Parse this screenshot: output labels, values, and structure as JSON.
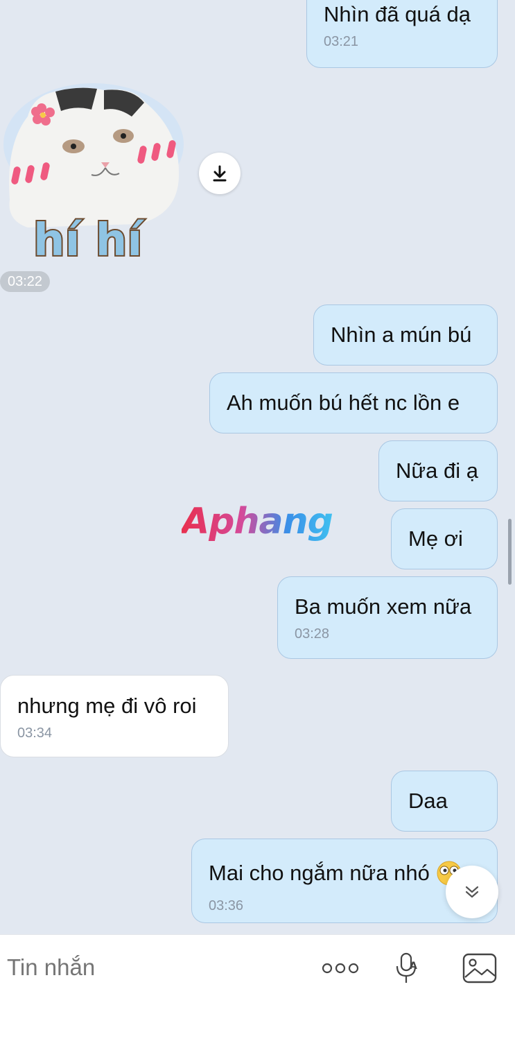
{
  "messages": [
    {
      "text": "Nhìn đã quá dạ",
      "time": "03:21"
    },
    {
      "sticker_text": "hí hí",
      "time": "03:22"
    },
    {
      "text": "Nhìn a mún bú"
    },
    {
      "text": "Ah muốn bú hết nc lồn e"
    },
    {
      "text": "Nữa đi ạ"
    },
    {
      "text": "Mẹ ơi"
    },
    {
      "text": "Ba muốn xem nữa",
      "time": "03:28"
    },
    {
      "text": "nhưng mẹ đi vô roi",
      "time": "03:34"
    },
    {
      "text": "Daa"
    },
    {
      "text": "Mai cho ngắm nữa nhó",
      "time": "03:36",
      "emoji": "wide-eyed-emoji"
    }
  ],
  "watermark": "Aphang",
  "composer": {
    "placeholder": "Tin nhắn",
    "icons": [
      "more-icon",
      "voice-to-text-icon",
      "image-icon"
    ]
  },
  "colors": {
    "background": "#e2e8f1",
    "outgoing_bubble": "#d3ebfb",
    "incoming_bubble": "#ffffff",
    "timestamp": "#8a95a3"
  }
}
